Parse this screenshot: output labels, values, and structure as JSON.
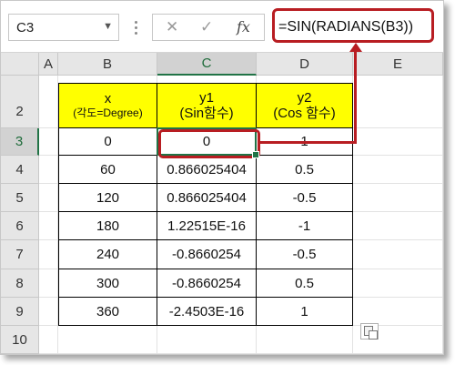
{
  "formula_bar": {
    "name_box": "C3",
    "cancel_glyph": "✕",
    "enter_glyph": "✓",
    "fx_label": "fx",
    "formula": "=SIN(RADIANS(B3))"
  },
  "columns": [
    "A",
    "B",
    "C",
    "D",
    "E"
  ],
  "rows": [
    "2",
    "3",
    "4",
    "5",
    "6",
    "7",
    "8",
    "9",
    "10"
  ],
  "table": {
    "headers": [
      {
        "line1": "x",
        "line2": "(각도=Degree)"
      },
      {
        "line1": "y1",
        "line2": "(Sin함수)"
      },
      {
        "line1": "y2",
        "line2": "(Cos 함수)"
      }
    ],
    "rows": [
      [
        "0",
        "0",
        "1"
      ],
      [
        "60",
        "0.866025404",
        "0.5"
      ],
      [
        "120",
        "0.866025404",
        "-0.5"
      ],
      [
        "180",
        "1.22515E-16",
        "-1"
      ],
      [
        "240",
        "-0.8660254",
        "-0.5"
      ],
      [
        "300",
        "-0.8660254",
        "0.5"
      ],
      [
        "360",
        "-2.4503E-16",
        "1"
      ]
    ]
  },
  "colors": {
    "header_fill": "#ffff00",
    "highlight": "#b81d22",
    "selection": "#217346"
  },
  "icons": [
    "chevron-down-icon",
    "cancel-icon",
    "enter-icon",
    "fx-icon",
    "paste-options-icon"
  ]
}
